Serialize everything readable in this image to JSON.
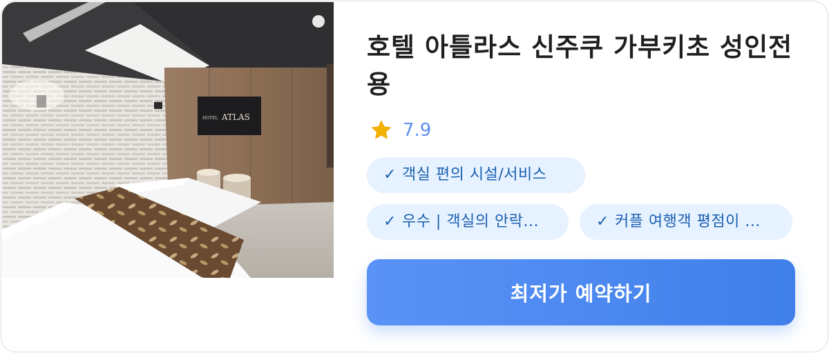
{
  "hotel": {
    "name": "호텔 아틀라스 신주쿠 가부키초 성인전용",
    "rating": "7.9",
    "photo_sign_small": "HOTEL",
    "photo_sign_large": "ATLAS"
  },
  "chips": [
    {
      "check": "✓",
      "label": "객실 편의 시설/서비스"
    },
    {
      "check": "✓",
      "label": "우수 | 객실의 안락..."
    },
    {
      "check": "✓",
      "label": "커플 여행객 평점이 ..."
    }
  ],
  "cta": {
    "label": "최저가 예약하기"
  },
  "icons": {
    "rating": "star-icon",
    "chip": "check-icon"
  },
  "colors": {
    "accent": "#4a87f0",
    "rating_text": "#5b8ff0",
    "chip_bg": "#e6f2ff",
    "chip_text": "#1b5fb0",
    "star": "#f5b301"
  }
}
